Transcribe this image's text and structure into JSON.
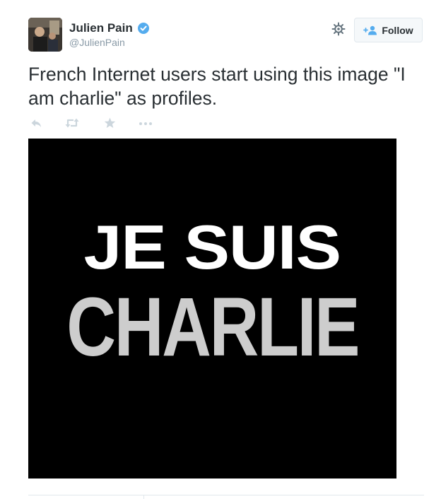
{
  "user": {
    "display_name": "Julien Pain",
    "handle": "@JulienPain",
    "verified": true,
    "avatar_icon": "profile-photo"
  },
  "header": {
    "settings_icon": "gear-icon",
    "follow_label": "Follow",
    "follow_icon": "add-user-icon"
  },
  "tweet": {
    "text": "French Internet users start using this image \"I am charlie\" as profiles."
  },
  "actions": {
    "reply_icon": "reply-icon",
    "retweet_icon": "retweet-icon",
    "favorite_icon": "star-icon",
    "more_icon": "more-icon"
  },
  "media": {
    "line1": "JE SUIS",
    "line2": "CHARLIE",
    "background": "#000000",
    "line1_color": "#ffffff",
    "line2_color": "#cdcdcd"
  },
  "colors": {
    "accent": "#55acee",
    "text": "#292f33",
    "muted": "#8899a6",
    "action_icons": "#ccd6dd"
  }
}
